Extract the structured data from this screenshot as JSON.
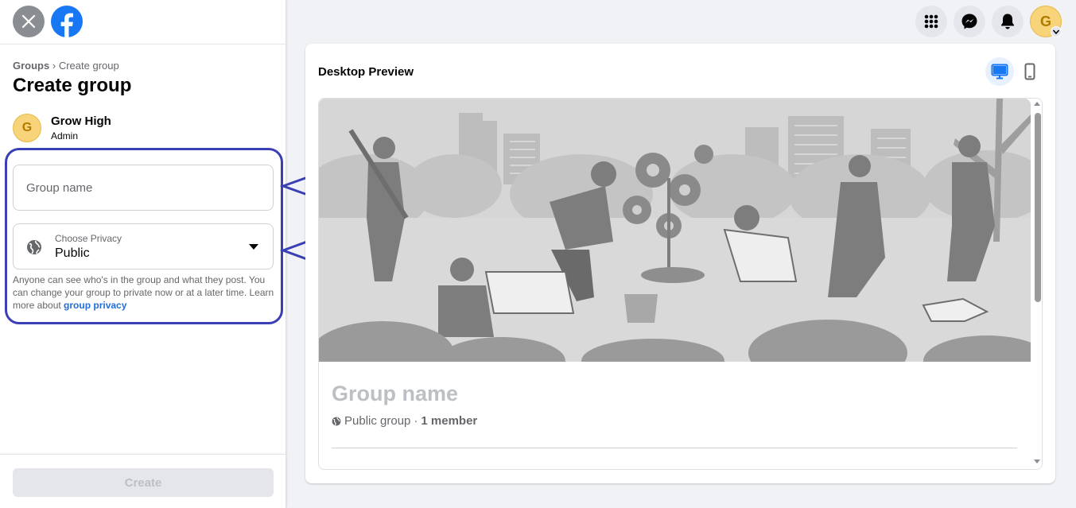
{
  "colors": {
    "brand_blue": "#1877f2",
    "link_blue": "#216fdb",
    "annotation_blue": "#3a3fb5",
    "avatar_yellow": "#f7d37a"
  },
  "header": {
    "close_icon": "close-icon",
    "logo_icon": "facebook-logo-icon"
  },
  "breadcrumb": {
    "parent": "Groups",
    "separator": "›",
    "current": "Create group"
  },
  "page_title": "Create group",
  "owner": {
    "initial": "G",
    "name": "Grow High",
    "role": "Admin"
  },
  "form": {
    "group_name_placeholder": "Group name",
    "group_name_value": "",
    "privacy_label": "Choose Privacy",
    "privacy_value": "Public",
    "privacy_help_text": "Anyone can see who's in the group and what they post. You can change your group to private now or at a later time. Learn more about ",
    "privacy_help_link": "group privacy",
    "create_label": "Create"
  },
  "topbar": {
    "icons": [
      "menu-grid-icon",
      "messenger-icon",
      "bell-icon"
    ],
    "avatar_initial": "G"
  },
  "preview": {
    "title": "Desktop Preview",
    "group_name": "Group name",
    "privacy": "Public group",
    "separator": "·",
    "members": "1 member"
  }
}
